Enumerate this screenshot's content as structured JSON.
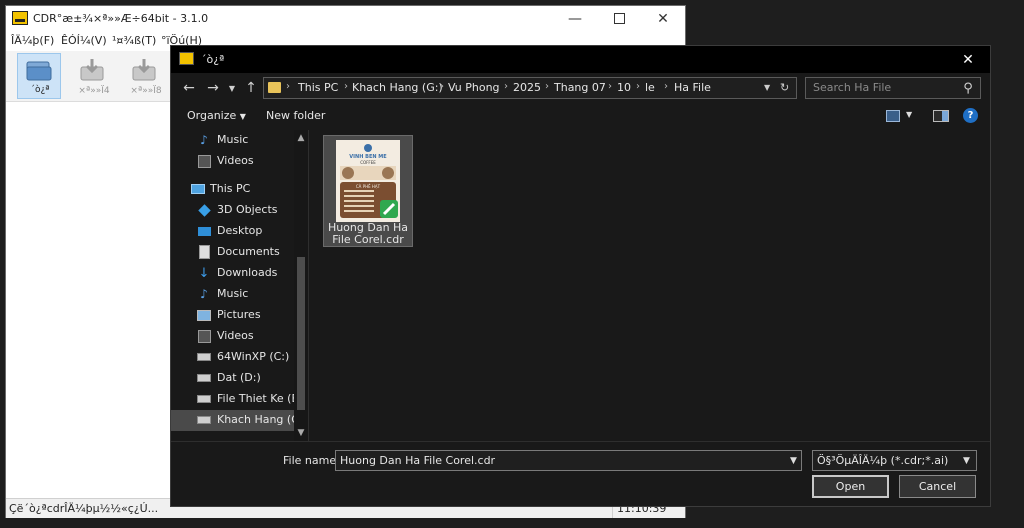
{
  "bg_window": {
    "title": "CDR°æ±¾×ª»»Æ÷64bit - 3.1.0",
    "menu": [
      "ÎÄ¼þ(F)",
      "ÊÓÍ¼(V)",
      "¹¤¾ß(T)",
      "°ïÖú(H)"
    ],
    "toolbar": [
      {
        "label": "´ò¿ª",
        "icon": "open-folder-icon"
      },
      {
        "label": "×ª»»Ϊ4",
        "icon": "convert-icon"
      },
      {
        "label": "×ª»»Ϊ8",
        "icon": "convert-icon"
      }
    ],
    "status_text": "Çë´ò¿ªcdrÎÄ¼þµ½½«ç¿Ú...",
    "status_time": "11:10:39"
  },
  "dialog": {
    "title": "´ò¿ª",
    "breadcrumb": [
      "This PC",
      "Khach Hang (G:)",
      "Vu Phong",
      "2025",
      "Thang 07",
      "10",
      "le",
      "Ha File"
    ],
    "search_placeholder": "Search Ha File",
    "organize_label": "Organize",
    "new_folder_label": "New folder",
    "nav_items": [
      {
        "label": "Music",
        "icon": "music-icon"
      },
      {
        "label": "Videos",
        "icon": "videos-icon"
      },
      {
        "label": "This PC",
        "icon": "computer-icon"
      },
      {
        "label": "3D Objects",
        "icon": "3d-objects-icon"
      },
      {
        "label": "Desktop",
        "icon": "desktop-icon"
      },
      {
        "label": "Documents",
        "icon": "documents-icon"
      },
      {
        "label": "Downloads",
        "icon": "download-icon"
      },
      {
        "label": "Music",
        "icon": "music-icon"
      },
      {
        "label": "Pictures",
        "icon": "pictures-icon"
      },
      {
        "label": "Videos",
        "icon": "videos-icon"
      },
      {
        "label": "64WinXP  (C:)",
        "icon": "drive-icon"
      },
      {
        "label": "Dat (D:)",
        "icon": "drive-icon"
      },
      {
        "label": "File Thiet Ke (E:)",
        "icon": "drive-icon"
      },
      {
        "label": "Khach Hang (G:)",
        "icon": "drive-icon"
      }
    ],
    "file": {
      "name": "Huong Dan Ha File Corel.cdr",
      "thumb_brand": "VINH BEN ME",
      "thumb_sub": "COFFEE",
      "thumb_menu": "CÀ PHÊ HẠT"
    },
    "file_name_label": "File name:",
    "file_name_value": "Huong Dan Ha File Corel.cdr",
    "file_type": "Ö§³ÖµÄÎÄ¼þ (*.cdr;*.ai)",
    "open_label": "Open",
    "cancel_label": "Cancel"
  }
}
